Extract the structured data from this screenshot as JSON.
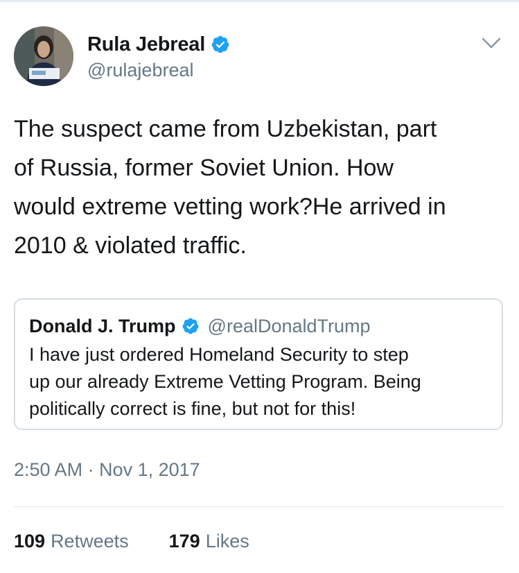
{
  "colors": {
    "text": "#14171a",
    "secondary": "#657786",
    "verified_blue": "#1da1f2",
    "border": "#d5dde3"
  },
  "author": {
    "display_name": "Rula Jebreal",
    "handle": "@rulajebreal",
    "verified": true,
    "avatar_icon": "profile-photo"
  },
  "tweet": {
    "text": "The suspect came from Uzbekistan, part\nof Russia, former Soviet Union. How\nwould extreme vetting work?He arrived in\n2010 & violated traffic."
  },
  "quoted_tweet": {
    "display_name": "Donald J. Trump",
    "handle": "@realDonaldTrump",
    "verified": true,
    "text": "I have just ordered Homeland Security to step\nup our already Extreme Vetting Program. Being\npolitically correct is fine, but not for this!"
  },
  "meta": {
    "timestamp": "2:50 AM · Nov 1, 2017"
  },
  "stats": {
    "retweets_count": "109",
    "retweets_label": "Retweets",
    "likes_count": "179",
    "likes_label": "Likes"
  },
  "icons": {
    "menu": "chevron-down-icon",
    "verified": "verified-badge-icon"
  }
}
